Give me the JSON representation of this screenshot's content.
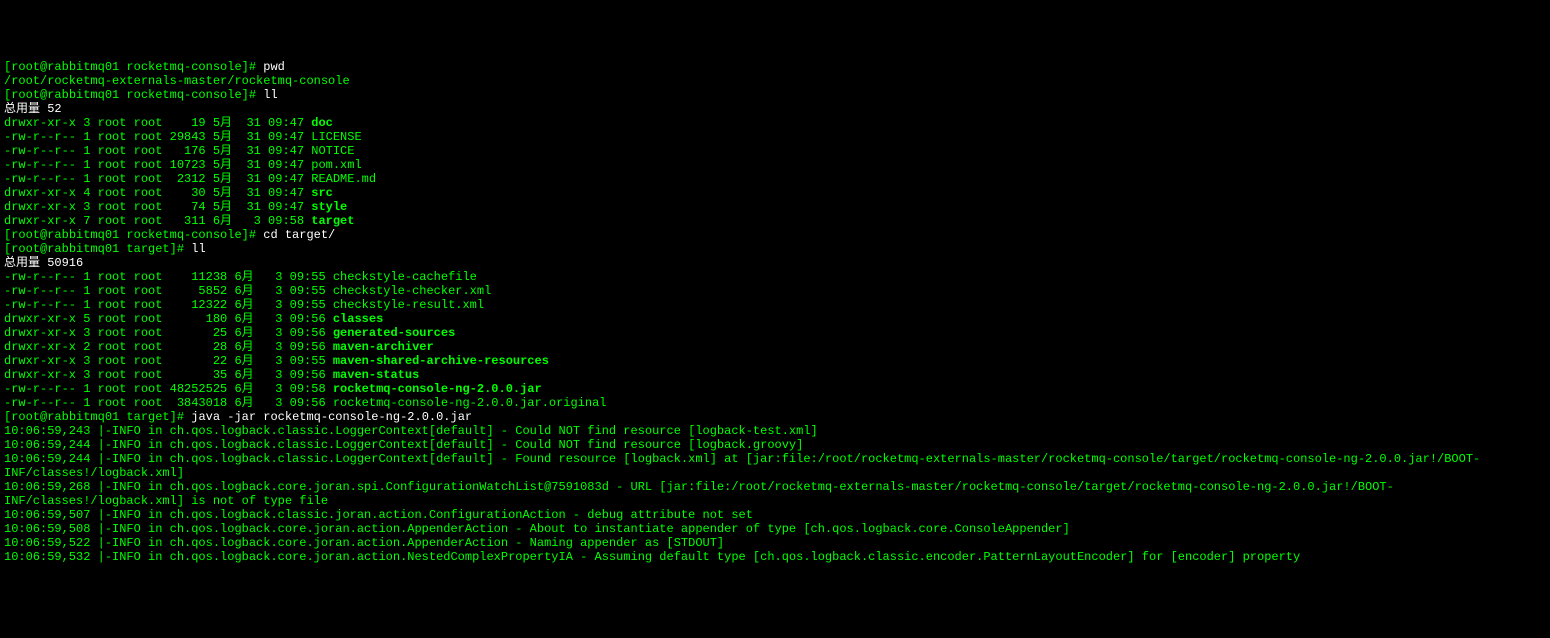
{
  "prompt1": {
    "bracket_open": "[",
    "user_host": "root@rabbitmq01 ",
    "dir": "rocketmq-console",
    "bracket_close": "]# ",
    "cmd": "pwd"
  },
  "pwd_out": "/root/rocketmq-externals-master/rocketmq-console",
  "prompt2": {
    "bracket_open": "[",
    "user_host": "root@rabbitmq01 ",
    "dir": "rocketmq-console",
    "bracket_close": "]# ",
    "cmd": "ll"
  },
  "total1": "总用量 52",
  "ls1": [
    {
      "perm": "drwxr-xr-x 3 root root    19 5月  31 09:47 ",
      "name": "doc",
      "bold": true
    },
    {
      "perm": "-rw-r--r-- 1 root root 29843 5月  31 09:47 ",
      "name": "LICENSE",
      "bold": false
    },
    {
      "perm": "-rw-r--r-- 1 root root   176 5月  31 09:47 ",
      "name": "NOTICE",
      "bold": false
    },
    {
      "perm": "-rw-r--r-- 1 root root 10723 5月  31 09:47 ",
      "name": "pom.xml",
      "bold": false
    },
    {
      "perm": "-rw-r--r-- 1 root root  2312 5月  31 09:47 ",
      "name": "README.md",
      "bold": false
    },
    {
      "perm": "drwxr-xr-x 4 root root    30 5月  31 09:47 ",
      "name": "src",
      "bold": true
    },
    {
      "perm": "drwxr-xr-x 3 root root    74 5月  31 09:47 ",
      "name": "style",
      "bold": true
    },
    {
      "perm": "drwxr-xr-x 7 root root   311 6月   3 09:58 ",
      "name": "target",
      "bold": true
    }
  ],
  "prompt3": {
    "bracket_open": "[",
    "user_host": "root@rabbitmq01 ",
    "dir": "rocketmq-console",
    "bracket_close": "]# ",
    "cmd": "cd target/"
  },
  "prompt4": {
    "bracket_open": "[",
    "user_host": "root@rabbitmq01 ",
    "dir": "target",
    "bracket_close": "]# ",
    "cmd": "ll"
  },
  "total2": "总用量 50916",
  "ls2": [
    {
      "perm": "-rw-r--r-- 1 root root    11238 6月   3 09:55 ",
      "name": "checkstyle-cachefile",
      "bold": false
    },
    {
      "perm": "-rw-r--r-- 1 root root     5852 6月   3 09:55 ",
      "name": "checkstyle-checker.xml",
      "bold": false
    },
    {
      "perm": "-rw-r--r-- 1 root root    12322 6月   3 09:55 ",
      "name": "checkstyle-result.xml",
      "bold": false
    },
    {
      "perm": "drwxr-xr-x 5 root root      180 6月   3 09:56 ",
      "name": "classes",
      "bold": true
    },
    {
      "perm": "drwxr-xr-x 3 root root       25 6月   3 09:56 ",
      "name": "generated-sources",
      "bold": true
    },
    {
      "perm": "drwxr-xr-x 2 root root       28 6月   3 09:56 ",
      "name": "maven-archiver",
      "bold": true
    },
    {
      "perm": "drwxr-xr-x 3 root root       22 6月   3 09:55 ",
      "name": "maven-shared-archive-resources",
      "bold": true
    },
    {
      "perm": "drwxr-xr-x 3 root root       35 6月   3 09:56 ",
      "name": "maven-status",
      "bold": true
    },
    {
      "perm": "-rw-r--r-- 1 root root 48252525 6月   3 09:58 ",
      "name": "rocketmq-console-ng-2.0.0.jar",
      "bold": true
    },
    {
      "perm": "-rw-r--r-- 1 root root  3843018 6月   3 09:56 ",
      "name": "rocketmq-console-ng-2.0.0.jar.original",
      "bold": false
    }
  ],
  "prompt5": {
    "bracket_open": "[",
    "user_host": "root@rabbitmq01 ",
    "dir": "target",
    "bracket_close": "]# ",
    "cmd": "java -jar rocketmq-console-ng-2.0.0.jar"
  },
  "log": [
    "10:06:59,243 |-INFO in ch.qos.logback.classic.LoggerContext[default] - Could NOT find resource [logback-test.xml]",
    "10:06:59,244 |-INFO in ch.qos.logback.classic.LoggerContext[default] - Could NOT find resource [logback.groovy]",
    "10:06:59,244 |-INFO in ch.qos.logback.classic.LoggerContext[default] - Found resource [logback.xml] at [jar:file:/root/rocketmq-externals-master/rocketmq-console/target/rocketmq-console-ng-2.0.0.jar!/BOOT-INF/classes!/logback.xml]",
    "10:06:59,268 |-INFO in ch.qos.logback.core.joran.spi.ConfigurationWatchList@7591083d - URL [jar:file:/root/rocketmq-externals-master/rocketmq-console/target/rocketmq-console-ng-2.0.0.jar!/BOOT-INF/classes!/logback.xml] is not of type file",
    "10:06:59,507 |-INFO in ch.qos.logback.classic.joran.action.ConfigurationAction - debug attribute not set",
    "10:06:59,508 |-INFO in ch.qos.logback.core.joran.action.AppenderAction - About to instantiate appender of type [ch.qos.logback.core.ConsoleAppender]",
    "10:06:59,522 |-INFO in ch.qos.logback.core.joran.action.AppenderAction - Naming appender as [STDOUT]",
    "10:06:59,532 |-INFO in ch.qos.logback.core.joran.action.NestedComplexPropertyIA - Assuming default type [ch.qos.logback.classic.encoder.PatternLayoutEncoder] for [encoder] property"
  ]
}
